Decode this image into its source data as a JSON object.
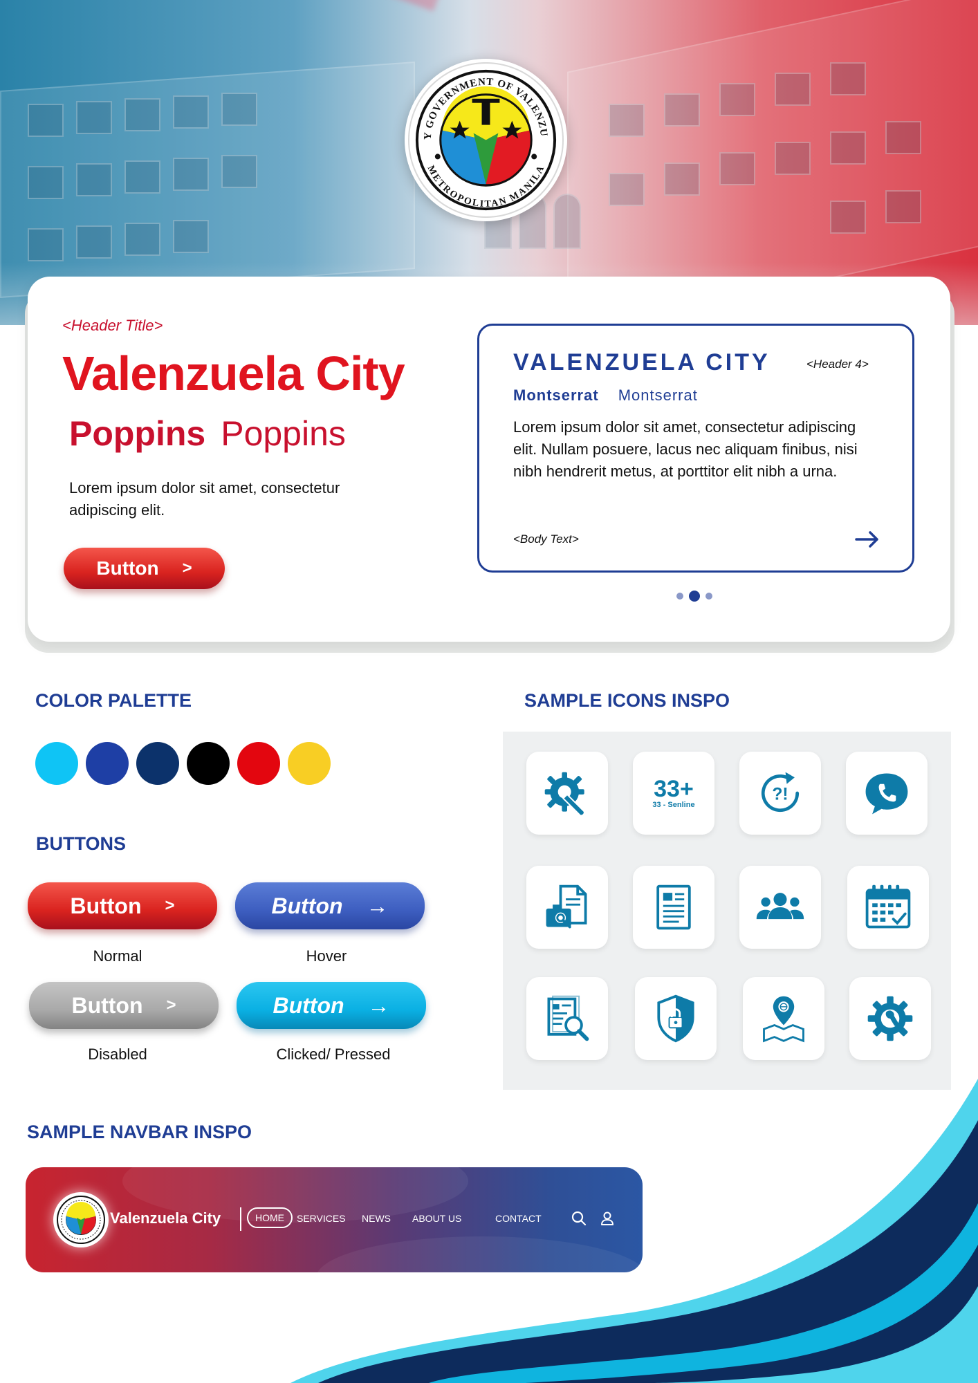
{
  "seal": {
    "ring_text_top": "CITY GOVERNMENT OF VALENZUELA",
    "ring_text_bottom": "METROPOLITAN MANILA"
  },
  "hero": {
    "header_title": "<Header Title>",
    "title": "Valenzuela City",
    "font_bold": "Poppins",
    "font_regular": "Poppins",
    "body": "Lorem ipsum dolor sit amet, consectetur adipiscing elit.",
    "button_label": "Button",
    "button_chevron": ">"
  },
  "info_card": {
    "title": "VALENZUELA CITY",
    "header4_label": "<Header 4>",
    "font_bold": "Montserrat",
    "font_regular": "Montserrat",
    "body": "Lorem ipsum dolor sit amet, consectetur adipiscing elit. Nullam posuere, lacus nec aliquam finibus, nisi nibh hendrerit metus, at porttitor elit nibh a urna.",
    "body_label": "<Body Text>",
    "carousel_dots": 3,
    "active_dot": 2
  },
  "color_palette": {
    "heading": "COLOR PALETTE",
    "colors": [
      "#0fc4f5",
      "#1e3fa5",
      "#0c326b",
      "#000000",
      "#e3060f",
      "#f8ce24"
    ]
  },
  "buttons": {
    "heading": "BUTTONS",
    "label": "Button",
    "chevron": ">",
    "arrow": "→",
    "states": [
      "Normal",
      "Hover",
      "Disabled",
      "Clicked/ Pressed"
    ]
  },
  "icons": {
    "heading": "SAMPLE ICONS INSPO",
    "hotline_big": "33+",
    "hotline_small": "33 - Senline",
    "items": [
      "settings-wrench-icon",
      "hotline-icon",
      "faq-refresh-icon",
      "phone-chat-icon",
      "document-search-folder-icon",
      "document-icon",
      "people-group-icon",
      "calendar-check-icon",
      "document-magnify-icon",
      "shield-lock-icon",
      "map-pin-icon",
      "gear-wrench-icon"
    ]
  },
  "navbar": {
    "heading": "SAMPLE NAVBAR INSPO",
    "brand": "Valenzuela City",
    "items": [
      "HOME",
      "SERVICES",
      "NEWS",
      "ABOUT US",
      "CONTACT"
    ]
  },
  "colors": {
    "primary_blue": "#1f3d94",
    "primary_red": "#e0141f",
    "icon_teal": "#0e7ba8"
  }
}
